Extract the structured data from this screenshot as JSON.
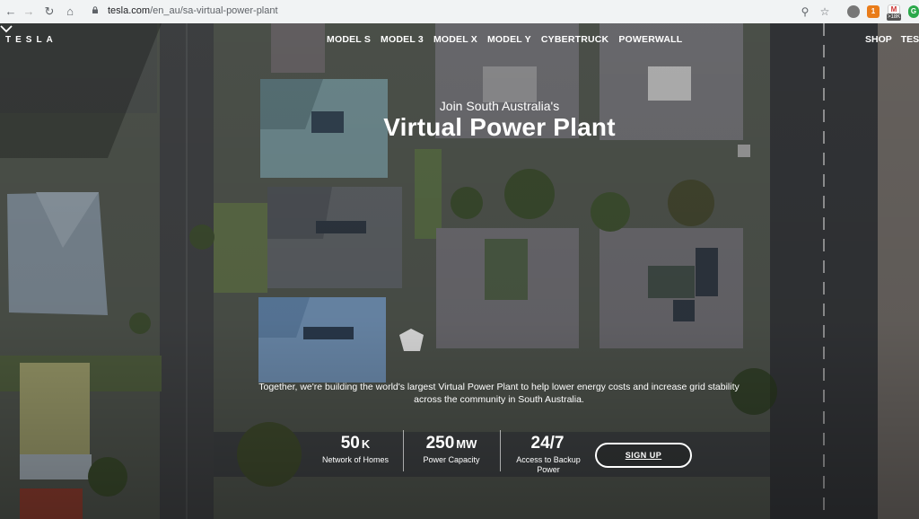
{
  "browser": {
    "url_host": "tesla.com",
    "url_path": "/en_au/sa-virtual-power-plant",
    "badge": ">18K"
  },
  "nav": {
    "logo": "TESLA",
    "items": [
      "MODEL S",
      "MODEL 3",
      "MODEL X",
      "MODEL Y",
      "CYBERTRUCK",
      "POWERWALL"
    ],
    "right": [
      "SHOP",
      "TES"
    ]
  },
  "hero": {
    "subtitle": "Join South Australia's",
    "title": "Virtual Power Plant",
    "blurb": "Together, we're building the world's largest Virtual Power Plant to help lower energy costs and increase grid stability across the community in South Australia."
  },
  "stats": [
    {
      "value": "50",
      "unit": "K",
      "label": "Network of Homes"
    },
    {
      "value": "250",
      "unit": "MW",
      "label": "Power Capacity"
    },
    {
      "value": "24/7",
      "unit": "",
      "label": "Access to Backup Power"
    }
  ],
  "cta": {
    "signup_label": "SIGN UP"
  },
  "icons": {
    "scroll": "chevron-down-icon"
  }
}
